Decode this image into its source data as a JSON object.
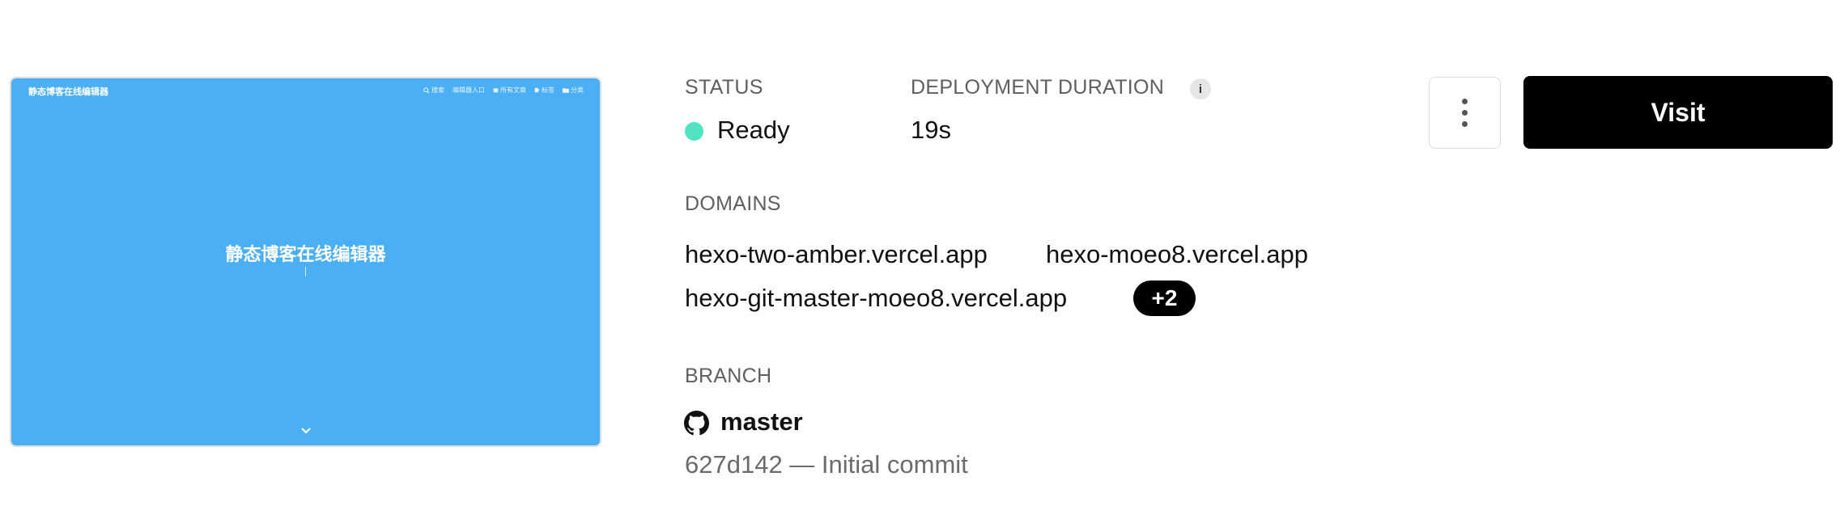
{
  "preview": {
    "site_title_small": "静态博客在线编辑器",
    "nav": [
      {
        "icon": "search-icon",
        "label": "搜索"
      },
      {
        "icon": "",
        "label": "编辑器入口"
      },
      {
        "icon": "archive-icon",
        "label": "所有文章"
      },
      {
        "icon": "tag-icon",
        "label": "标签"
      },
      {
        "icon": "folder-icon",
        "label": "分类"
      }
    ],
    "hero_title": "静态博客在线编辑器",
    "background_color": "#4aaff5"
  },
  "status": {
    "label": "STATUS",
    "value": "Ready",
    "color": "#50e3c2"
  },
  "duration": {
    "label": "DEPLOYMENT DURATION",
    "value": "19s",
    "info_icon_text": "i"
  },
  "domains": {
    "label": "DOMAINS",
    "items": [
      "hexo-two-amber.vercel.app",
      "hexo-moeo8.vercel.app",
      "hexo-git-master-moeo8.vercel.app"
    ],
    "more": "+2"
  },
  "branch": {
    "label": "BRANCH",
    "name": "master",
    "commit": "627d142 — Initial commit"
  },
  "actions": {
    "visit_label": "Visit"
  }
}
